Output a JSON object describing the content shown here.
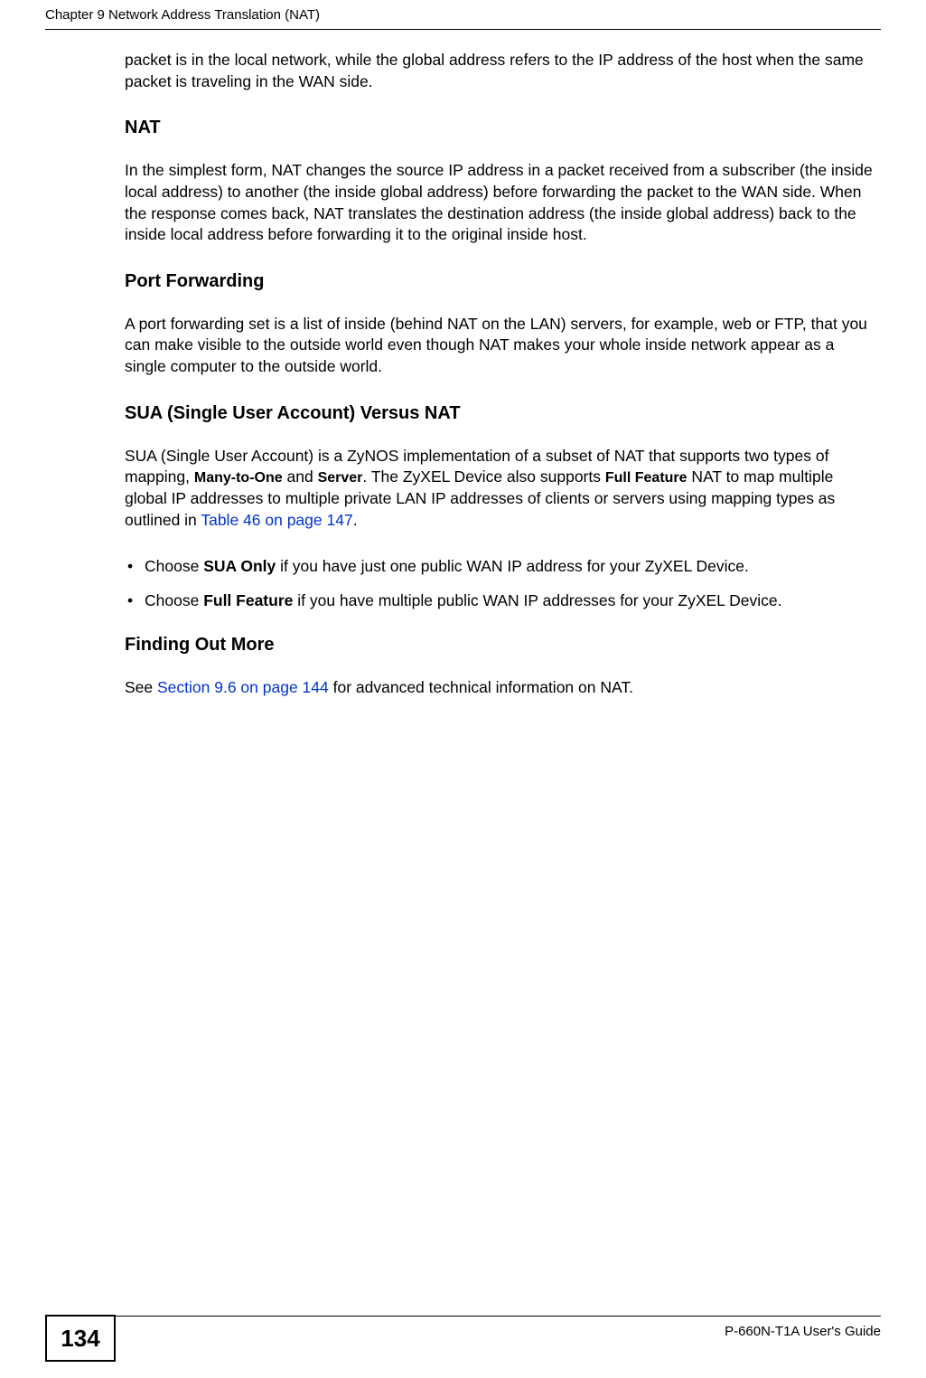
{
  "header": {
    "chapter_title": "Chapter 9 Network Address Translation (NAT)"
  },
  "intro_paragraph": "packet is in the local network, while the global address refers to the IP address of the host when the same packet is traveling in the WAN side.",
  "sections": {
    "nat": {
      "heading": "NAT",
      "body": "In the simplest form, NAT changes the source IP address in a packet received from a subscriber (the inside local address) to another (the inside global address) before forwarding the packet to the WAN side. When the response comes back, NAT translates the destination address (the inside global address) back to the inside local address before forwarding it to the original inside host."
    },
    "port_forwarding": {
      "heading": "Port Forwarding",
      "body": "A port forwarding set is a list of inside (behind NAT on the LAN) servers, for example, web or FTP, that you can make visible to the outside world even though NAT makes your whole inside network appear as a single computer to the outside world."
    },
    "sua": {
      "heading": "SUA (Single User Account) Versus NAT",
      "body_pre": "SUA (Single User Account) is a ZyNOS implementation of a subset of NAT that supports two types of mapping, ",
      "bold1": "Many-to-One",
      "mid1": " and ",
      "bold2": "Server",
      "mid2": ". The ZyXEL Device also supports ",
      "bold3": "Full Feature",
      "mid3": " NAT to map multiple global IP addresses to multiple private LAN IP addresses of clients or servers using mapping types as outlined in ",
      "link_text": "Table 46 on page 147",
      "tail": ".",
      "bullets": [
        {
          "pre": "Choose ",
          "bold": "SUA Only",
          "post": " if you have just one public WAN IP address for your ZyXEL Device."
        },
        {
          "pre": "Choose ",
          "bold": "Full Feature",
          "post": " if you have multiple public WAN IP addresses for your ZyXEL Device."
        }
      ]
    },
    "finding_out_more": {
      "heading": "Finding Out More",
      "pre": "See ",
      "link_text": "Section 9.6 on page 144",
      "post": " for advanced technical information on NAT."
    }
  },
  "footer": {
    "page_number": "134",
    "guide_label": "P-660N-T1A User's Guide"
  }
}
